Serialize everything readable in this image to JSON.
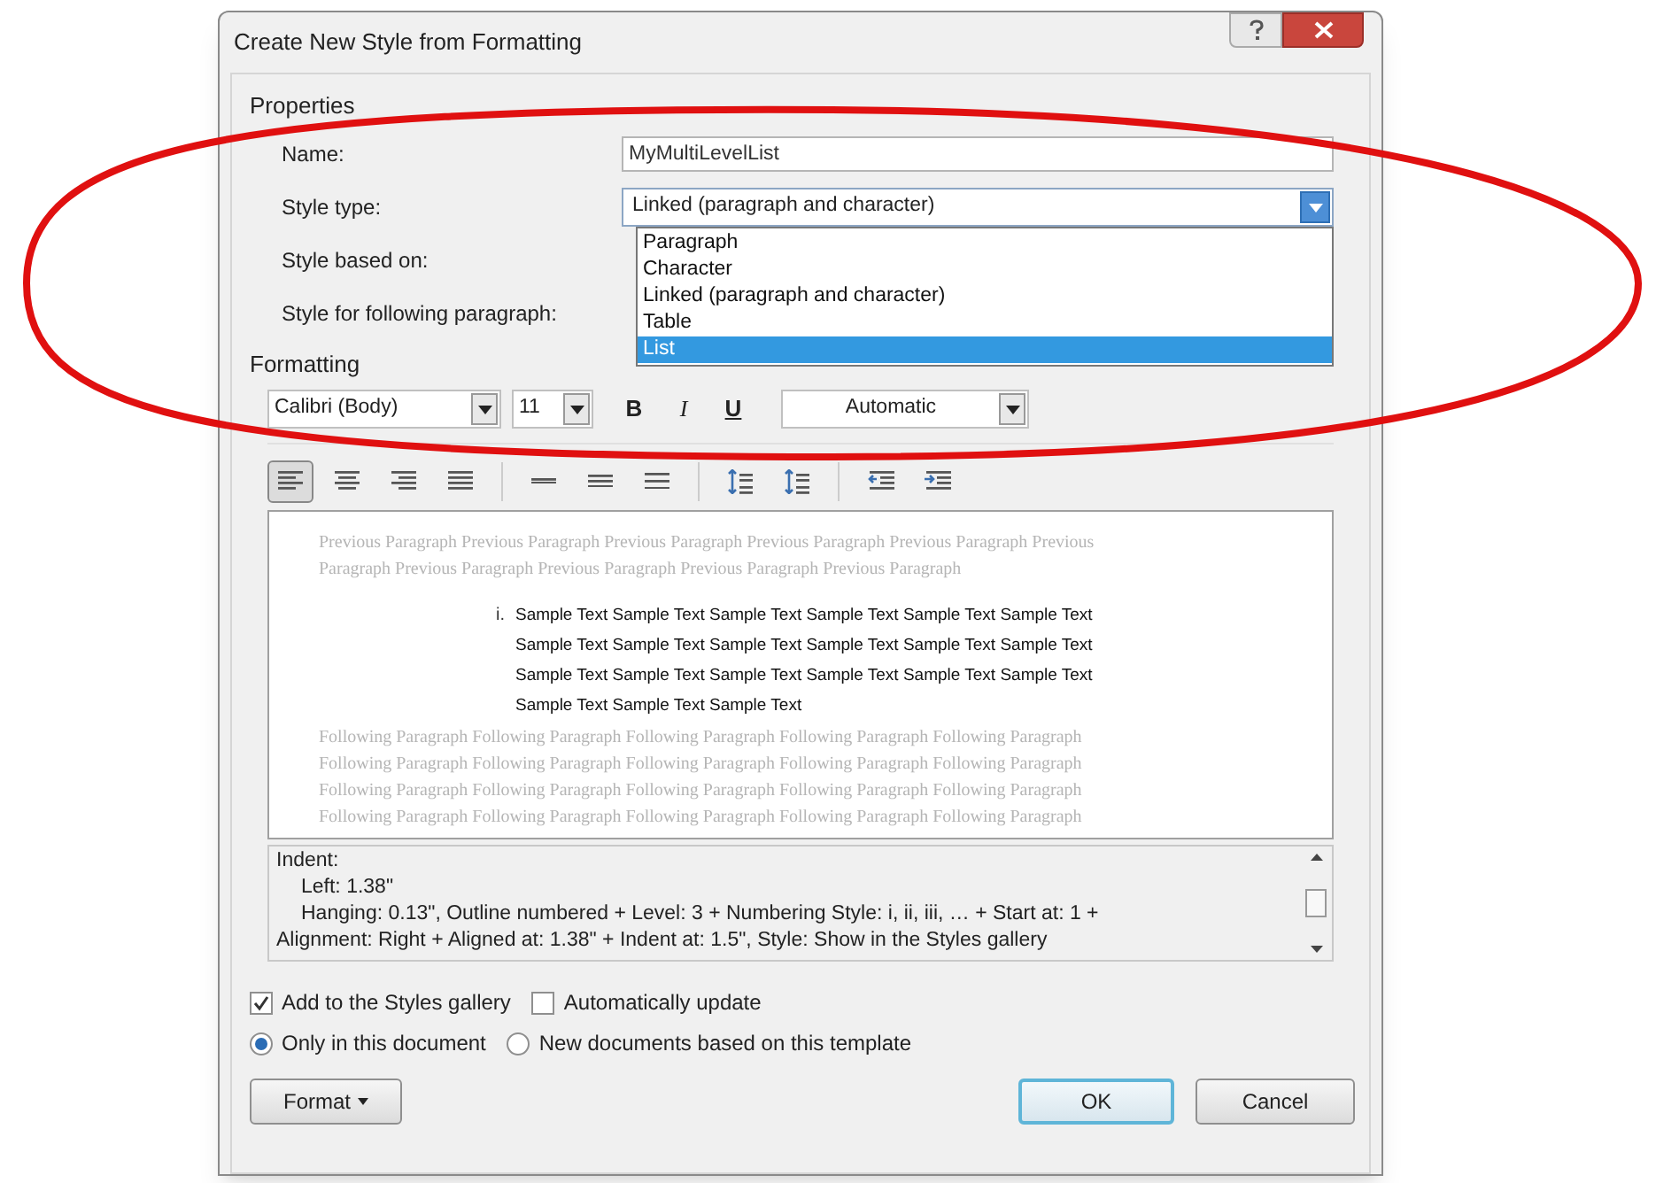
{
  "window": {
    "title": "Create New Style from Formatting"
  },
  "properties": {
    "label": "Properties",
    "fields": [
      {
        "label": "Name:",
        "value": "MyMultiLevelList",
        "kind": "text"
      },
      {
        "label": "Style type:",
        "value": "Linked (paragraph and character)",
        "kind": "combo"
      },
      {
        "label": "Style based on:",
        "kind": "hidden"
      },
      {
        "label": "Style for following paragraph:",
        "kind": "hidden"
      }
    ]
  },
  "style_type_list": [
    {
      "label": "Paragraph",
      "selected": false
    },
    {
      "label": "Character",
      "selected": false
    },
    {
      "label": "Linked (paragraph and character)",
      "selected": false
    },
    {
      "label": "Table",
      "selected": false
    },
    {
      "label": "List",
      "selected": true
    }
  ],
  "formatting": {
    "label": "Formatting",
    "font": "Calibri (Body)",
    "size": "11",
    "bold": "B",
    "italic": "I",
    "underline": "U",
    "font_color": "Automatic"
  },
  "paragraph_tools": [
    {
      "kind": "align-left",
      "selected": true
    },
    {
      "kind": "align-center",
      "selected": false
    },
    {
      "kind": "align-right",
      "selected": false
    },
    {
      "kind": "justify",
      "selected": false
    },
    {
      "kind": "single",
      "selected": false
    },
    {
      "kind": "one-half",
      "selected": false
    },
    {
      "kind": "double",
      "selected": false
    },
    {
      "kind": "space-up",
      "selected": false
    },
    {
      "kind": "space-down",
      "selected": false
    },
    {
      "kind": "outdent",
      "selected": false
    },
    {
      "kind": "indent",
      "selected": false
    }
  ],
  "preview": {
    "previous": [
      "Previous Paragraph Previous Paragraph Previous Paragraph Previous Paragraph Previous Paragraph Previous",
      "Paragraph Previous Paragraph Previous Paragraph Previous Paragraph Previous Paragraph"
    ],
    "list_number": "i.",
    "sample": [
      "Sample Text Sample Text Sample Text Sample Text Sample Text Sample Text",
      "Sample Text Sample Text Sample Text Sample Text Sample Text Sample Text",
      "Sample Text Sample Text Sample Text Sample Text Sample Text Sample Text",
      "Sample Text Sample Text Sample Text"
    ],
    "following": [
      "Following Paragraph Following Paragraph Following Paragraph Following Paragraph Following Paragraph",
      "Following Paragraph Following Paragraph Following Paragraph Following Paragraph Following Paragraph",
      "Following Paragraph Following Paragraph Following Paragraph Following Paragraph Following Paragraph",
      "Following Paragraph Following Paragraph Following Paragraph Following Paragraph Following Paragraph"
    ]
  },
  "description": [
    {
      "text": "Indent:",
      "kind": "heading"
    },
    {
      "text": "Left:  1.38\"",
      "kind": "indented"
    },
    {
      "text": "Hanging:  0.13\", Outline numbered + Level: 3 + Numbering Style: i, ii, iii, … + Start at: 1 +",
      "kind": "indented"
    },
    {
      "text": "Alignment: Right + Aligned at:  1.38\" + Indent at:  1.5\", Style: Show in the Styles gallery",
      "kind": "plain"
    }
  ],
  "options": [
    {
      "label": "Add to the Styles gallery",
      "checked": true
    },
    {
      "label": "Automatically update",
      "checked": false
    }
  ],
  "scope": [
    {
      "label": "Only in this document",
      "selected": true
    },
    {
      "label": "New documents based on this template",
      "selected": false
    }
  ],
  "buttons": {
    "format": "Format",
    "ok": "OK",
    "cancel": "Cancel"
  }
}
